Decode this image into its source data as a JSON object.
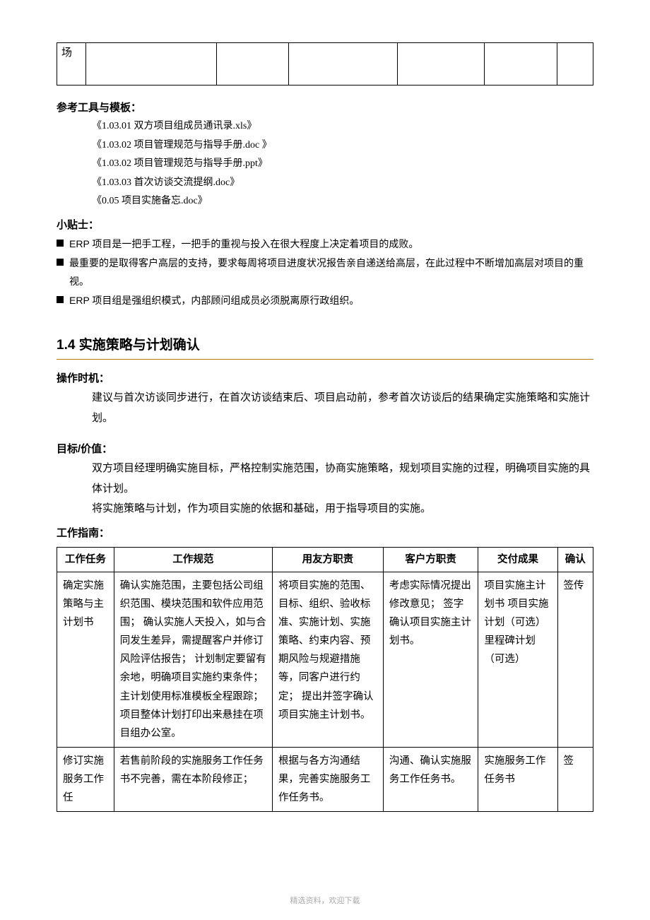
{
  "topTable": {
    "cell": "场"
  },
  "refTools": {
    "label": "参考工具与模板：",
    "items": [
      "《1.03.01 双方项目组成员通讯录.xls》",
      "《1.03.02 项目管理规范与指导手册.doc 》",
      "《1.03.02 项目管理规范与指导手册.ppt》",
      "《1.03.03 首次访谈交流提纲.doc》",
      "《0.05 项目实施备忘.doc》"
    ]
  },
  "tips": {
    "label": "小贴士：",
    "items": [
      "ERP 项目是一把手工程，一把手的重视与投入在很大程度上决定着项目的成败。",
      "最重要的是取得客户高层的支持，要求每周将项目进度状况报告亲自递送给高层，在此过程中不断增加高层对项目的重视。",
      "ERP 项目组是强组织模式，内部顾问组成员必须脱离原行政组织。"
    ]
  },
  "section": {
    "title": "1.4 实施策略与计划确认",
    "timingLabel": "操作时机：",
    "timingText": "建议与首次访谈同步进行，在首次访谈结束后、项目启动前，参考首次访谈后的结果确定实施策略和实施计划。",
    "valueLabel": "目标/价值：",
    "valueText1": "双方项目经理明确实施目标，严格控制实施范围，协商实施策略，规划项目实施的过程，明确项目实施的具体计划。",
    "valueText2": "将实施策略与计划，作为项目实施的依据和基础，用于指导项目的实施。",
    "guideLabel": "工作指南："
  },
  "mainTable": {
    "headers": [
      "工作任务",
      "工作规范",
      "用友方职责",
      "客户方职责",
      "交付成果",
      "确认"
    ],
    "rows": [
      {
        "task": "确定实施策略与主计划书",
        "spec": "确认实施范围，主要包括公司组织范围、模块范围和软件应用范围；\n确认实施人天投入，如与合同发生差异，需提醒客户并修订风险评估报告；\n计划制定要留有余地，明确项目实施约束条件；\n主计划使用标准模板全程跟踪；\n项目整体计划打印出来悬挂在项目组办公室。",
        "uf": "将项目实施的范围、目标、组织、验收标准、实施计划、实施策略、约束内容、预期风险与规避措施等，同客户进行约定；\n提出并签字确认项目实施主计划书。",
        "cust": "考虑实际情况提出修改意见；\n签字确认项目实施主计划书。",
        "deliver": "项目实施主计划书\n项目实施计划（可选）\n里程碑计划（可选）",
        "confirm": "签传"
      },
      {
        "task": "修订实施服务工作任",
        "spec": "若售前阶段的实施服务工作任务书不完善，需在本阶段修正；",
        "uf": "根据与各方沟通结果，完善实施服务工作任务书。",
        "cust": "沟通、确认实施服务工作任务书。",
        "deliver": "实施服务工作任务书",
        "confirm": "签"
      }
    ]
  },
  "footer": "精选资料，欢迎下载"
}
